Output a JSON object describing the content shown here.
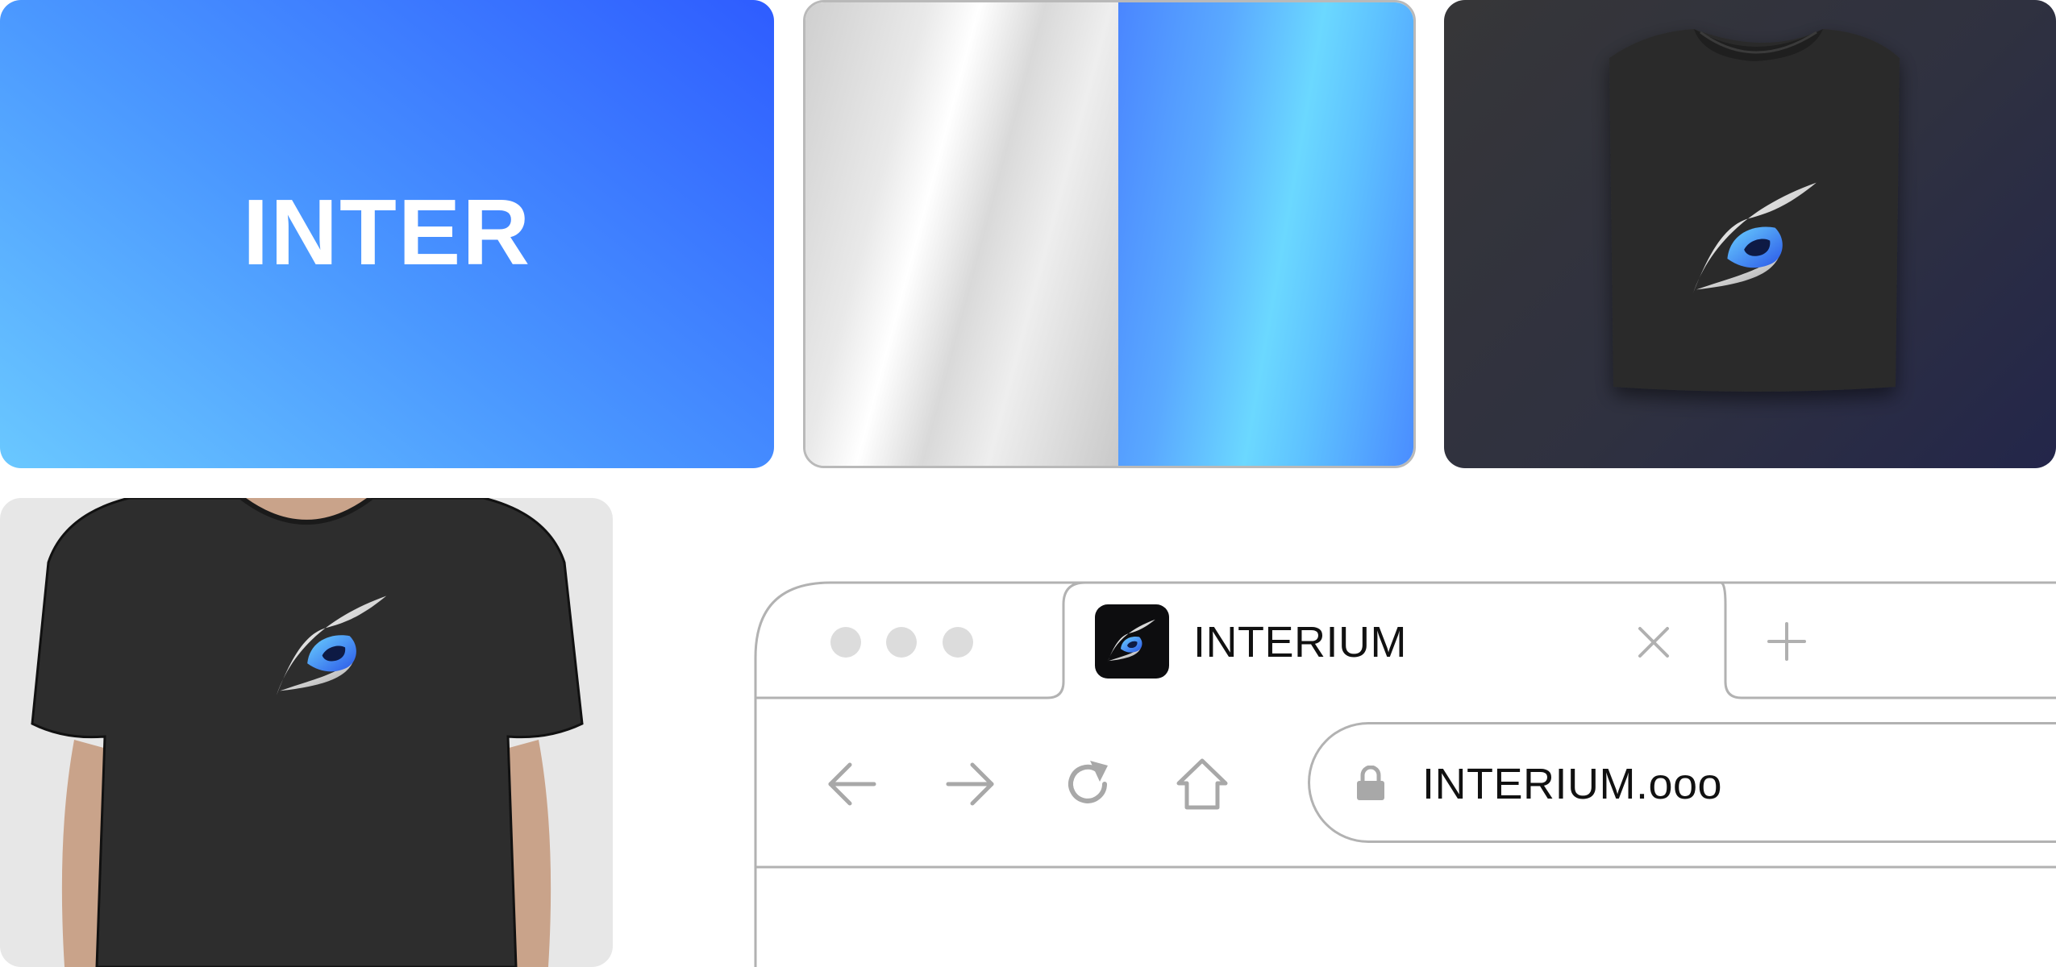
{
  "wordmark": {
    "text": "INTER"
  },
  "swatches": {
    "colors": [
      "#d9d9d9",
      "#5aa9ff"
    ]
  },
  "mockups": {
    "icon": "eye-logo-icon"
  },
  "browser": {
    "tab": {
      "title": "INTERIUM",
      "favicon": "eye-logo-icon",
      "close_icon": "close-icon"
    },
    "new_tab_icon": "plus-icon",
    "window_controls": [
      "dot",
      "dot",
      "dot"
    ],
    "nav": [
      "back-arrow-icon",
      "forward-arrow-icon",
      "reload-icon",
      "home-icon"
    ],
    "address": {
      "url": "INTERIUM.ooo",
      "icon": "lock-icon"
    }
  }
}
